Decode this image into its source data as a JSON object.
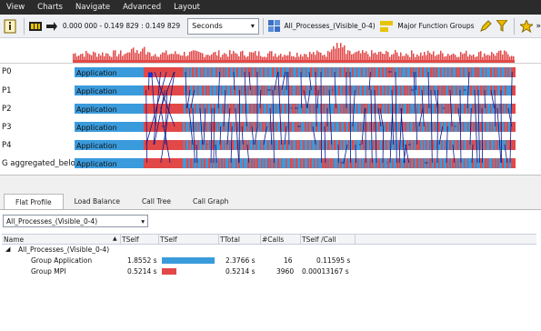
{
  "menu": [
    "View",
    "Charts",
    "Navigate",
    "Advanced",
    "Layout"
  ],
  "toolbar": {
    "time_range": "0.000 000 - 0.149 829 : 0.149 829",
    "units": "Seconds",
    "process_group": "All_Processes_(Visible_0-4)",
    "function_groups": "Major Function Groups"
  },
  "rows": [
    {
      "label": "P0",
      "first": "Application"
    },
    {
      "label": "P1",
      "first": "Application"
    },
    {
      "label": "P2",
      "first": "Application"
    },
    {
      "label": "P3",
      "first": "Application"
    },
    {
      "label": "P4",
      "first": "Application"
    },
    {
      "label": "G aggregated_below",
      "first": "Application"
    }
  ],
  "bottom": {
    "tabs": [
      "Flat Profile",
      "Load Balance",
      "Call Tree",
      "Call Graph"
    ],
    "process_select": "All_Processes_(Visible_0-4)",
    "headers": {
      "name": "Name",
      "tself1": "TSelf",
      "tself2": "TSelf",
      "ttotal": "TTotal",
      "calls": "#Calls",
      "tselfcall": "TSelf /Call"
    },
    "group_root": "All_Processes_(Visible_0-4)",
    "items": [
      {
        "name": "Group Application",
        "tself": "1.8552 s",
        "ttotal": "2.3766 s",
        "calls": "16",
        "percall": "0.11595 s",
        "bar_fraction": 1.0,
        "color": "#3a9bdc"
      },
      {
        "name": "Group MPI",
        "tself": "0.5214 s",
        "ttotal": "0.5214 s",
        "calls": "3960",
        "percall": "0.00013167 s",
        "bar_fraction": 0.281,
        "color": "#e24848"
      }
    ]
  },
  "colors": {
    "application": "#3a9bdc",
    "mpi": "#e24848",
    "message": "#0a1a8c"
  }
}
